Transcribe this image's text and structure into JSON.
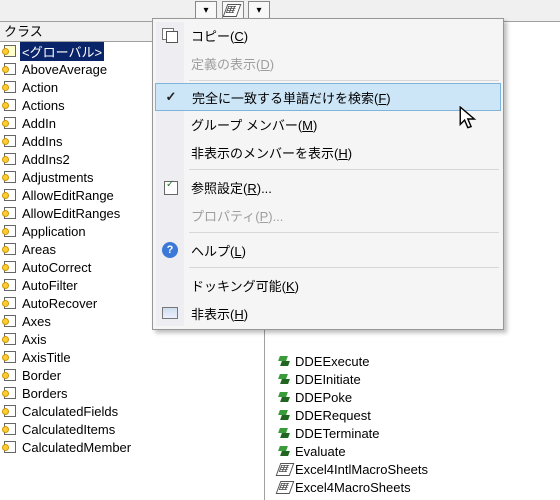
{
  "left_panel": {
    "header": "クラス",
    "items": [
      {
        "label": "<グローバル>",
        "selected": true,
        "global": true
      },
      {
        "label": "AboveAverage"
      },
      {
        "label": "Action"
      },
      {
        "label": "Actions"
      },
      {
        "label": "AddIn"
      },
      {
        "label": "AddIns"
      },
      {
        "label": "AddIns2"
      },
      {
        "label": "Adjustments"
      },
      {
        "label": "AllowEditRange"
      },
      {
        "label": "AllowEditRanges"
      },
      {
        "label": "Application"
      },
      {
        "label": "Areas"
      },
      {
        "label": "AutoCorrect"
      },
      {
        "label": "AutoFilter"
      },
      {
        "label": "AutoRecover"
      },
      {
        "label": "Axes"
      },
      {
        "label": "Axis"
      },
      {
        "label": "AxisTitle"
      },
      {
        "label": "Border"
      },
      {
        "label": "Borders"
      },
      {
        "label": "CalculatedFields"
      },
      {
        "label": "CalculatedItems"
      },
      {
        "label": "CalculatedMember"
      }
    ]
  },
  "right_panel": {
    "items": [
      {
        "label": "DDEExecute",
        "icon": "method"
      },
      {
        "label": "DDEInitiate",
        "icon": "method"
      },
      {
        "label": "DDEPoke",
        "icon": "method"
      },
      {
        "label": "DDERequest",
        "icon": "method"
      },
      {
        "label": "DDETerminate",
        "icon": "method"
      },
      {
        "label": "Evaluate",
        "icon": "method"
      },
      {
        "label": "Excel4IntlMacroSheets",
        "icon": "sheet"
      },
      {
        "label": "Excel4MacroSheets",
        "icon": "sheet"
      }
    ]
  },
  "context_menu": {
    "items": [
      {
        "type": "item",
        "label": "コピー",
        "accel": "C",
        "icon": "copy"
      },
      {
        "type": "item",
        "label": "定義の表示",
        "accel": "D",
        "disabled": true
      },
      {
        "type": "sep"
      },
      {
        "type": "item",
        "label": "完全に一致する単語だけを検索",
        "accel": "F",
        "checked": true,
        "highlight": true
      },
      {
        "type": "item",
        "label": "グループ メンバー",
        "accel": "M"
      },
      {
        "type": "item",
        "label": "非表示のメンバーを表示",
        "accel": "H"
      },
      {
        "type": "sep"
      },
      {
        "type": "item",
        "label": "参照設定",
        "accel": "R",
        "suffix": "...",
        "icon": "ref"
      },
      {
        "type": "item",
        "label": "プロパティ",
        "accel": "P",
        "suffix": "...",
        "disabled": true
      },
      {
        "type": "sep"
      },
      {
        "type": "item",
        "label": "ヘルプ",
        "accel": "L",
        "icon": "help"
      },
      {
        "type": "sep"
      },
      {
        "type": "item",
        "label": "ドッキング可能",
        "accel": "K"
      },
      {
        "type": "item",
        "label": "非表示",
        "accel": "H",
        "icon": "hide"
      }
    ]
  }
}
